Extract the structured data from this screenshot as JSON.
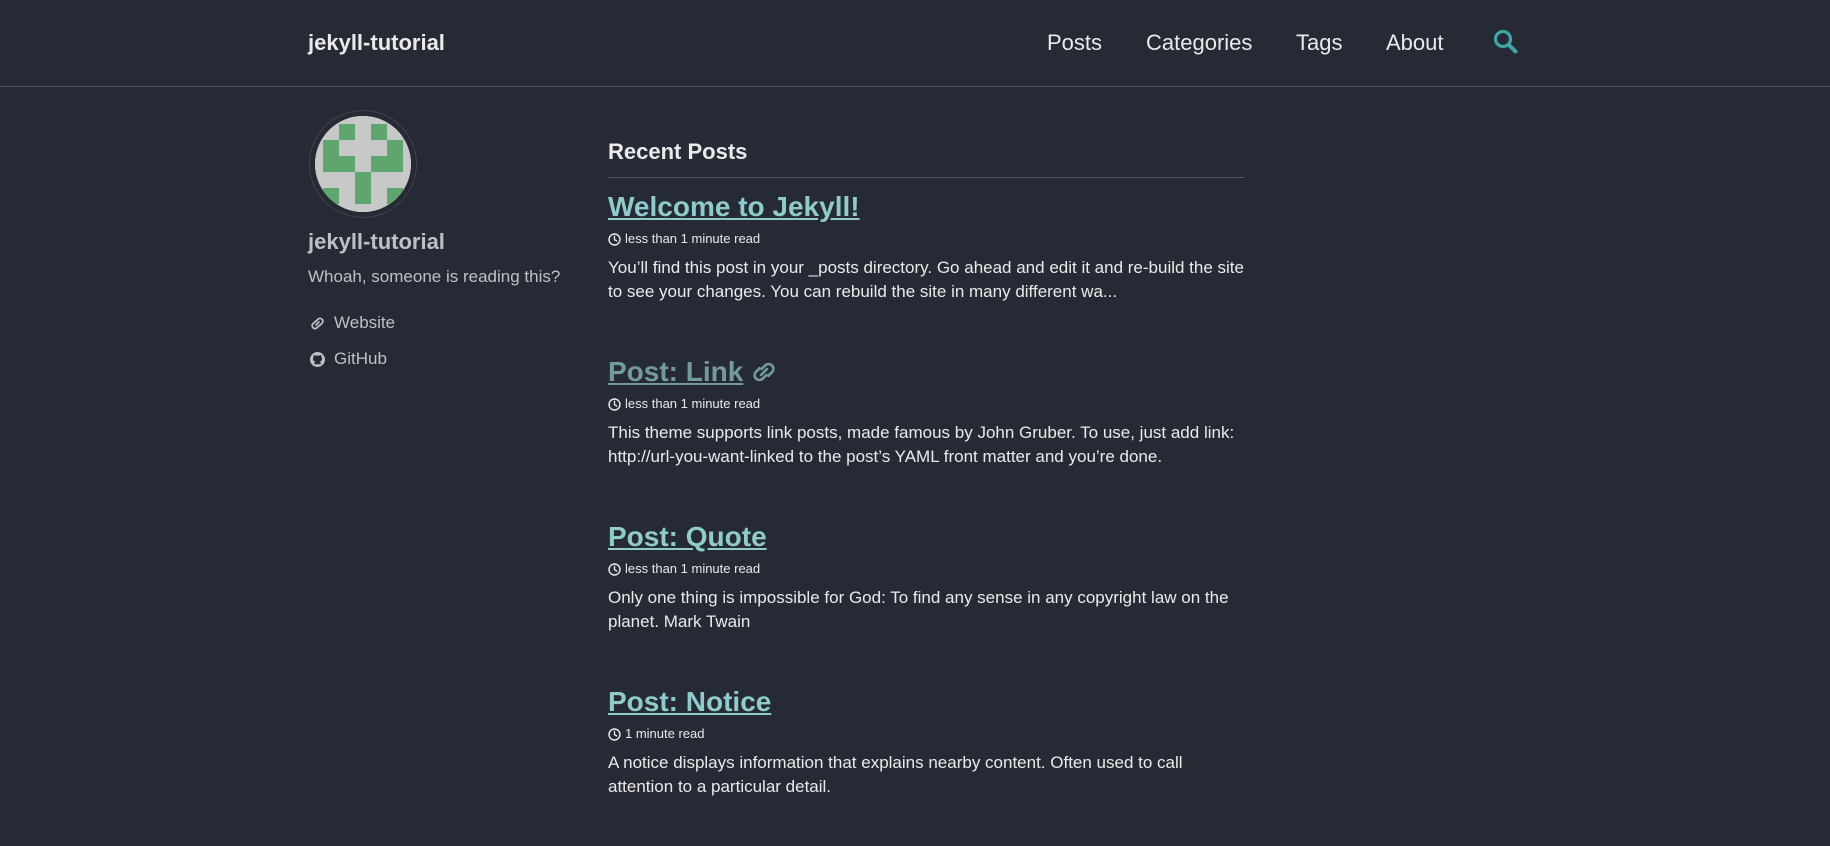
{
  "header": {
    "site_title": "jekyll-tutorial",
    "nav": [
      {
        "label": "Posts"
      },
      {
        "label": "Categories"
      },
      {
        "label": "Tags"
      },
      {
        "label": "About"
      }
    ],
    "search_icon": "search-icon"
  },
  "sidebar": {
    "author_name": "jekyll-tutorial",
    "bio": "Whoah, someone is reading this?",
    "links": [
      {
        "label": "Website",
        "icon": "link-icon"
      },
      {
        "label": "GitHub",
        "icon": "github-icon"
      }
    ]
  },
  "main": {
    "heading": "Recent Posts",
    "posts": [
      {
        "title": "Welcome to Jekyll!",
        "read_time": "less than 1 minute read",
        "excerpt": "You’ll find this post in your _posts directory. Go ahead and edit it and re-build the site to see your changes. You can rebuild the site in many different wa..."
      },
      {
        "title": "Post: Link",
        "read_time": "less than 1 minute read",
        "excerpt": "This theme supports link posts, made famous by John Gruber. To use, just add link: http://url-you-want-linked to the post’s YAML front matter and you’re done."
      },
      {
        "title": "Post: Quote",
        "read_time": "less than 1 minute read",
        "excerpt": "Only one thing is impossible for God: To find any sense in any copyright law on the planet. Mark Twain"
      },
      {
        "title": "Post: Notice",
        "read_time": "1 minute read",
        "excerpt": "A notice displays information that explains nearby content. Often used to call attention to a particular detail."
      }
    ]
  },
  "colors": {
    "background": "#252a34",
    "text": "#eaeaea",
    "link": "#8fcbca",
    "link_post": "#729b9b",
    "search_accent": "#3fa7a5",
    "avatar_identicon": "#5fa56e"
  }
}
